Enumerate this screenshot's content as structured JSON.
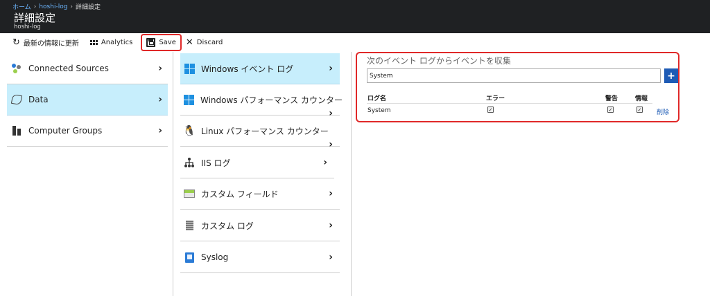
{
  "breadcrumb": {
    "home": "ホーム",
    "workspace": "hoshi-log",
    "current": "詳細設定"
  },
  "header": {
    "title": "詳細設定",
    "subtitle": "hoshi-log"
  },
  "toolbar": {
    "refresh": "最新の情報に更新",
    "analytics": "Analytics",
    "save": "Save",
    "discard": "Discard"
  },
  "left_nav": [
    {
      "label": "Connected Sources",
      "icon": "connected-sources-icon",
      "selected": false
    },
    {
      "label": "Data",
      "icon": "data-icon",
      "selected": true
    },
    {
      "label": "Computer Groups",
      "icon": "computer-groups-icon",
      "selected": false
    }
  ],
  "mid_nav": [
    {
      "label": "Windows イベント ログ",
      "icon": "windows-icon",
      "selected": true
    },
    {
      "label": "Windows パフォーマンス カウンター",
      "icon": "windows-icon",
      "selected": false
    },
    {
      "label": "Linux パフォーマンス カウンター",
      "icon": "linux-icon",
      "selected": false
    },
    {
      "label": "IIS ログ",
      "icon": "iis-icon",
      "selected": false
    },
    {
      "label": "カスタム フィールド",
      "icon": "custom-field-icon",
      "selected": false
    },
    {
      "label": "カスタム ログ",
      "icon": "custom-log-icon",
      "selected": false
    },
    {
      "label": "Syslog",
      "icon": "syslog-icon",
      "selected": false
    }
  ],
  "event_logs": {
    "title": "次のイベント ログからイベントを収集",
    "input_value": "System",
    "add_label": "+",
    "columns": [
      "ログ名",
      "エラー",
      "警告",
      "情報"
    ],
    "rows": [
      {
        "name": "System",
        "error": true,
        "warning": true,
        "info": true,
        "action": "削除"
      }
    ]
  },
  "colors": {
    "header_bg": "#1f2123",
    "selected_bg": "#c7eefc",
    "accent": "#1e5bb5",
    "highlight": "#e02828"
  }
}
